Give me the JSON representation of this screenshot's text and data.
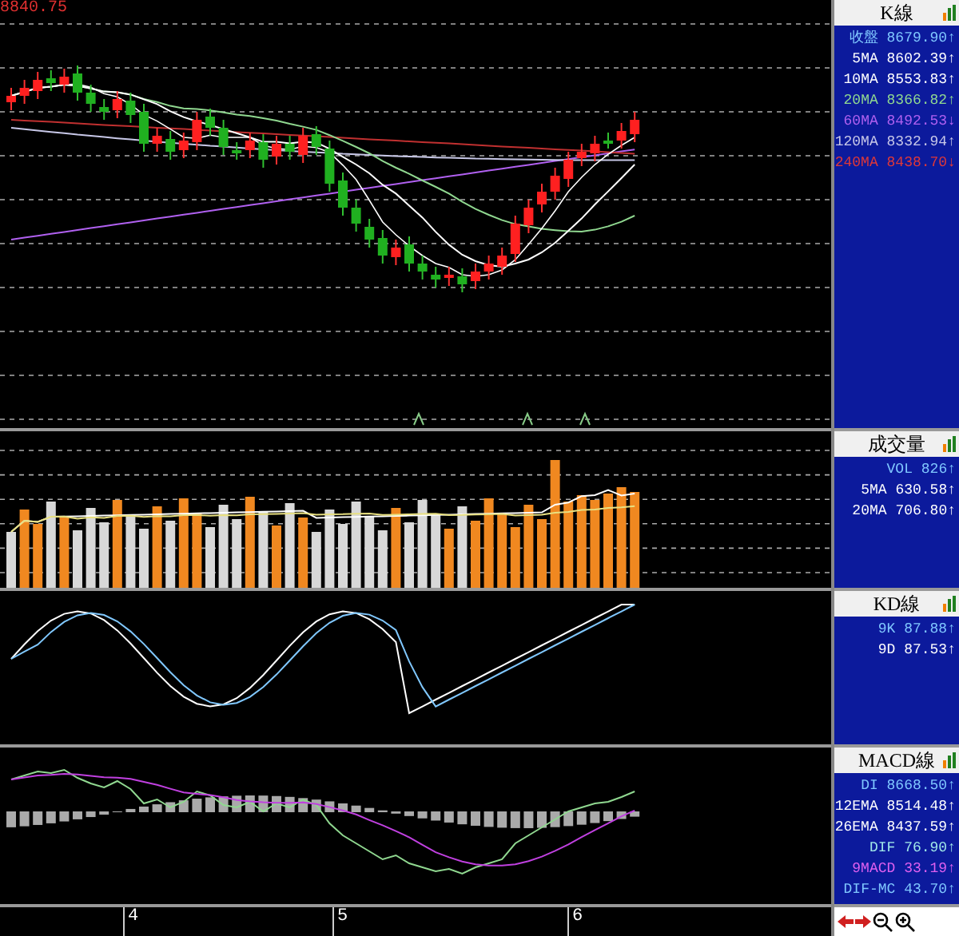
{
  "price_high": "8840.75",
  "panels": [
    {
      "kind": "k",
      "title": "K線",
      "rows": [
        {
          "label": "收盤",
          "value": "8679.90",
          "arrow": "↑",
          "color": "#80c8ff"
        },
        {
          "label": "5MA",
          "value": "8602.39",
          "arrow": "↑",
          "color": "#ffffff"
        },
        {
          "label": "10MA",
          "value": "8553.83",
          "arrow": "↑",
          "color": "#ffffff"
        },
        {
          "label": "20MA",
          "value": "8366.82",
          "arrow": "↑",
          "color": "#90d890"
        },
        {
          "label": "60MA",
          "value": "8492.53",
          "arrow": "↓",
          "color": "#b060f0"
        },
        {
          "label": "120MA",
          "value": "8332.94",
          "arrow": "↑",
          "color": "#c8c8e8"
        },
        {
          "label": "240MA",
          "value": "8438.70",
          "arrow": "↓",
          "color": "#e03838"
        }
      ]
    },
    {
      "kind": "volume",
      "title": "成交量",
      "rows": [
        {
          "label": "VOL",
          "value": "826",
          "arrow": "↑",
          "color": "#80c8ff"
        },
        {
          "label": "5MA",
          "value": "630.58",
          "arrow": "↑",
          "color": "#ffffff"
        },
        {
          "label": "20MA",
          "value": "706.80",
          "arrow": "↑",
          "color": "#ffffff"
        }
      ]
    },
    {
      "kind": "kd",
      "title": "KD線",
      "rows": [
        {
          "label": "9K",
          "value": "87.88",
          "arrow": "↑",
          "color": "#80c8ff"
        },
        {
          "label": "9D",
          "value": "87.53",
          "arrow": "↑",
          "color": "#ffffff"
        }
      ]
    },
    {
      "kind": "macd",
      "title": "MACD線",
      "rows": [
        {
          "label": "DI",
          "value": "8668.50",
          "arrow": "↑",
          "color": "#80c8ff"
        },
        {
          "label": "12EMA",
          "value": "8514.48",
          "arrow": "↑",
          "color": "#ffffff"
        },
        {
          "label": "26EMA",
          "value": "8437.59",
          "arrow": "↑",
          "color": "#ffffff"
        },
        {
          "label": "DIF",
          "value": "76.90",
          "arrow": "↑",
          "color": "#a0e8e8"
        },
        {
          "label": "9MACD",
          "value": "33.19",
          "arrow": "↑",
          "color": "#e060f0"
        },
        {
          "label": "DIF-MC",
          "value": "43.70",
          "arrow": "↑",
          "color": "#80c8ff"
        }
      ]
    }
  ],
  "x_axis": [
    "4",
    "5",
    "6"
  ]
}
